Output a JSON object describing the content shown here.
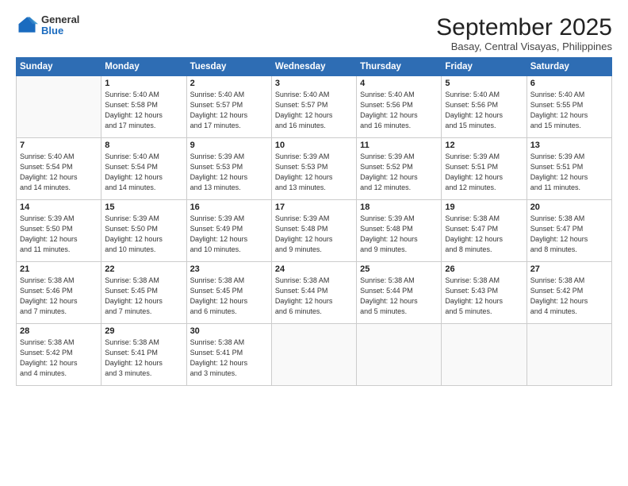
{
  "logo": {
    "general": "General",
    "blue": "Blue"
  },
  "title": "September 2025",
  "subtitle": "Basay, Central Visayas, Philippines",
  "headers": [
    "Sunday",
    "Monday",
    "Tuesday",
    "Wednesday",
    "Thursday",
    "Friday",
    "Saturday"
  ],
  "weeks": [
    [
      {
        "day": "",
        "info": ""
      },
      {
        "day": "1",
        "info": "Sunrise: 5:40 AM\nSunset: 5:58 PM\nDaylight: 12 hours\nand 17 minutes."
      },
      {
        "day": "2",
        "info": "Sunrise: 5:40 AM\nSunset: 5:57 PM\nDaylight: 12 hours\nand 17 minutes."
      },
      {
        "day": "3",
        "info": "Sunrise: 5:40 AM\nSunset: 5:57 PM\nDaylight: 12 hours\nand 16 minutes."
      },
      {
        "day": "4",
        "info": "Sunrise: 5:40 AM\nSunset: 5:56 PM\nDaylight: 12 hours\nand 16 minutes."
      },
      {
        "day": "5",
        "info": "Sunrise: 5:40 AM\nSunset: 5:56 PM\nDaylight: 12 hours\nand 15 minutes."
      },
      {
        "day": "6",
        "info": "Sunrise: 5:40 AM\nSunset: 5:55 PM\nDaylight: 12 hours\nand 15 minutes."
      }
    ],
    [
      {
        "day": "7",
        "info": "Sunrise: 5:40 AM\nSunset: 5:54 PM\nDaylight: 12 hours\nand 14 minutes."
      },
      {
        "day": "8",
        "info": "Sunrise: 5:40 AM\nSunset: 5:54 PM\nDaylight: 12 hours\nand 14 minutes."
      },
      {
        "day": "9",
        "info": "Sunrise: 5:39 AM\nSunset: 5:53 PM\nDaylight: 12 hours\nand 13 minutes."
      },
      {
        "day": "10",
        "info": "Sunrise: 5:39 AM\nSunset: 5:53 PM\nDaylight: 12 hours\nand 13 minutes."
      },
      {
        "day": "11",
        "info": "Sunrise: 5:39 AM\nSunset: 5:52 PM\nDaylight: 12 hours\nand 12 minutes."
      },
      {
        "day": "12",
        "info": "Sunrise: 5:39 AM\nSunset: 5:51 PM\nDaylight: 12 hours\nand 12 minutes."
      },
      {
        "day": "13",
        "info": "Sunrise: 5:39 AM\nSunset: 5:51 PM\nDaylight: 12 hours\nand 11 minutes."
      }
    ],
    [
      {
        "day": "14",
        "info": "Sunrise: 5:39 AM\nSunset: 5:50 PM\nDaylight: 12 hours\nand 11 minutes."
      },
      {
        "day": "15",
        "info": "Sunrise: 5:39 AM\nSunset: 5:50 PM\nDaylight: 12 hours\nand 10 minutes."
      },
      {
        "day": "16",
        "info": "Sunrise: 5:39 AM\nSunset: 5:49 PM\nDaylight: 12 hours\nand 10 minutes."
      },
      {
        "day": "17",
        "info": "Sunrise: 5:39 AM\nSunset: 5:48 PM\nDaylight: 12 hours\nand 9 minutes."
      },
      {
        "day": "18",
        "info": "Sunrise: 5:39 AM\nSunset: 5:48 PM\nDaylight: 12 hours\nand 9 minutes."
      },
      {
        "day": "19",
        "info": "Sunrise: 5:38 AM\nSunset: 5:47 PM\nDaylight: 12 hours\nand 8 minutes."
      },
      {
        "day": "20",
        "info": "Sunrise: 5:38 AM\nSunset: 5:47 PM\nDaylight: 12 hours\nand 8 minutes."
      }
    ],
    [
      {
        "day": "21",
        "info": "Sunrise: 5:38 AM\nSunset: 5:46 PM\nDaylight: 12 hours\nand 7 minutes."
      },
      {
        "day": "22",
        "info": "Sunrise: 5:38 AM\nSunset: 5:45 PM\nDaylight: 12 hours\nand 7 minutes."
      },
      {
        "day": "23",
        "info": "Sunrise: 5:38 AM\nSunset: 5:45 PM\nDaylight: 12 hours\nand 6 minutes."
      },
      {
        "day": "24",
        "info": "Sunrise: 5:38 AM\nSunset: 5:44 PM\nDaylight: 12 hours\nand 6 minutes."
      },
      {
        "day": "25",
        "info": "Sunrise: 5:38 AM\nSunset: 5:44 PM\nDaylight: 12 hours\nand 5 minutes."
      },
      {
        "day": "26",
        "info": "Sunrise: 5:38 AM\nSunset: 5:43 PM\nDaylight: 12 hours\nand 5 minutes."
      },
      {
        "day": "27",
        "info": "Sunrise: 5:38 AM\nSunset: 5:42 PM\nDaylight: 12 hours\nand 4 minutes."
      }
    ],
    [
      {
        "day": "28",
        "info": "Sunrise: 5:38 AM\nSunset: 5:42 PM\nDaylight: 12 hours\nand 4 minutes."
      },
      {
        "day": "29",
        "info": "Sunrise: 5:38 AM\nSunset: 5:41 PM\nDaylight: 12 hours\nand 3 minutes."
      },
      {
        "day": "30",
        "info": "Sunrise: 5:38 AM\nSunset: 5:41 PM\nDaylight: 12 hours\nand 3 minutes."
      },
      {
        "day": "",
        "info": ""
      },
      {
        "day": "",
        "info": ""
      },
      {
        "day": "",
        "info": ""
      },
      {
        "day": "",
        "info": ""
      }
    ]
  ]
}
